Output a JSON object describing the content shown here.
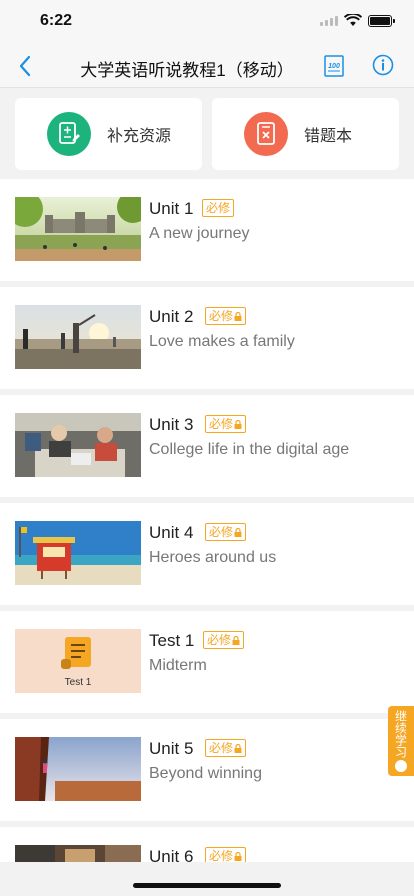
{
  "status": {
    "time": "6:22"
  },
  "nav": {
    "title": "大学英语听说教程1（移动）",
    "score_icon_text": "100"
  },
  "actions": [
    {
      "label": "补充资源",
      "icon": "document-pen-icon",
      "color": "#1db37d"
    },
    {
      "label": "错题本",
      "icon": "wrong-book-icon",
      "color": "#f26a4f"
    }
  ],
  "units": [
    {
      "title": "Unit 1",
      "badge": "必修",
      "locked": false,
      "subtitle": "A new journey",
      "thumb": "campus-photo"
    },
    {
      "title": "Unit 2",
      "badge": "必修",
      "locked": true,
      "subtitle": "Love makes a family",
      "thumb": "beach-family-photo"
    },
    {
      "title": "Unit 3",
      "badge": "必修",
      "locked": true,
      "subtitle": "College life in the digital age",
      "thumb": "study-room-photo"
    },
    {
      "title": "Unit 4",
      "badge": "必修",
      "locked": true,
      "subtitle": "Heroes around us",
      "thumb": "lifeguard-hut-photo"
    },
    {
      "title": "Test 1",
      "badge": "必修",
      "locked": true,
      "subtitle": "Midterm",
      "thumb": "test-scroll",
      "thumb_label": "Test 1"
    },
    {
      "title": "Unit 5",
      "badge": "必修",
      "locked": true,
      "subtitle": "Beyond winning",
      "thumb": "climber-photo"
    },
    {
      "title": "Unit 6",
      "badge": "必修",
      "locked": true,
      "subtitle": "",
      "thumb": "classroom-photo"
    }
  ],
  "continue_tab": {
    "label": "继续学习"
  },
  "colors": {
    "accent": "#f5a623",
    "nav_blue": "#1a8fe3"
  }
}
